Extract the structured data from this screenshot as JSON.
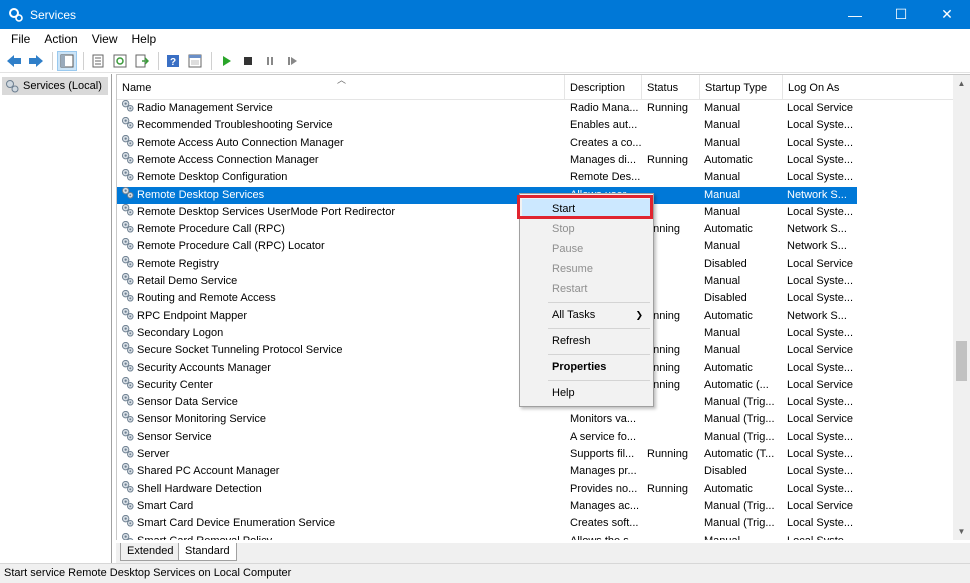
{
  "window": {
    "title": "Services",
    "minimize": "—",
    "maximize": "☐",
    "close": "✕"
  },
  "menu": [
    "File",
    "Action",
    "View",
    "Help"
  ],
  "tree": {
    "root_label": "Services (Local)"
  },
  "columns": {
    "name": "Name",
    "description": "Description",
    "status": "Status",
    "startup_type": "Startup Type",
    "log_on_as": "Log On As"
  },
  "rows": [
    {
      "name": "Radio Management Service",
      "description": "Radio Mana...",
      "status": "Running",
      "startup": "Manual",
      "logon": "Local Service"
    },
    {
      "name": "Recommended Troubleshooting Service",
      "description": "Enables aut...",
      "status": "",
      "startup": "Manual",
      "logon": "Local Syste..."
    },
    {
      "name": "Remote Access Auto Connection Manager",
      "description": "Creates a co...",
      "status": "",
      "startup": "Manual",
      "logon": "Local Syste..."
    },
    {
      "name": "Remote Access Connection Manager",
      "description": "Manages di...",
      "status": "Running",
      "startup": "Automatic",
      "logon": "Local Syste..."
    },
    {
      "name": "Remote Desktop Configuration",
      "description": "Remote Des...",
      "status": "",
      "startup": "Manual",
      "logon": "Local Syste..."
    },
    {
      "name": "Remote Desktop Services",
      "description": "Allows user...",
      "status": "",
      "startup": "Manual",
      "logon": "Network S...",
      "selected": true
    },
    {
      "name": "Remote Desktop Services UserMode Port Redirector",
      "description": "",
      "status": "",
      "startup": "Manual",
      "logon": "Local Syste..."
    },
    {
      "name": "Remote Procedure Call (RPC)",
      "description": "",
      "status": "unning",
      "startup": "Automatic",
      "logon": "Network S..."
    },
    {
      "name": "Remote Procedure Call (RPC) Locator",
      "description": "",
      "status": "",
      "startup": "Manual",
      "logon": "Network S..."
    },
    {
      "name": "Remote Registry",
      "description": "",
      "status": "",
      "startup": "Disabled",
      "logon": "Local Service"
    },
    {
      "name": "Retail Demo Service",
      "description": "",
      "status": "",
      "startup": "Manual",
      "logon": "Local Syste..."
    },
    {
      "name": "Routing and Remote Access",
      "description": "",
      "status": "",
      "startup": "Disabled",
      "logon": "Local Syste..."
    },
    {
      "name": "RPC Endpoint Mapper",
      "description": "",
      "status": "unning",
      "startup": "Automatic",
      "logon": "Network S..."
    },
    {
      "name": "Secondary Logon",
      "description": "",
      "status": "",
      "startup": "Manual",
      "logon": "Local Syste..."
    },
    {
      "name": "Secure Socket Tunneling Protocol Service",
      "description": "",
      "status": "unning",
      "startup": "Manual",
      "logon": "Local Service"
    },
    {
      "name": "Security Accounts Manager",
      "description": "",
      "status": "unning",
      "startup": "Automatic",
      "logon": "Local Syste..."
    },
    {
      "name": "Security Center",
      "description": "",
      "status": "unning",
      "startup": "Automatic (...",
      "logon": "Local Service"
    },
    {
      "name": "Sensor Data Service",
      "description": "",
      "status": "",
      "startup": "Manual (Trig...",
      "logon": "Local Syste..."
    },
    {
      "name": "Sensor Monitoring Service",
      "description": "Monitors va...",
      "status": "",
      "startup": "Manual (Trig...",
      "logon": "Local Service"
    },
    {
      "name": "Sensor Service",
      "description": "A service fo...",
      "status": "",
      "startup": "Manual (Trig...",
      "logon": "Local Syste..."
    },
    {
      "name": "Server",
      "description": "Supports fil...",
      "status": "Running",
      "startup": "Automatic (T...",
      "logon": "Local Syste..."
    },
    {
      "name": "Shared PC Account Manager",
      "description": "Manages pr...",
      "status": "",
      "startup": "Disabled",
      "logon": "Local Syste..."
    },
    {
      "name": "Shell Hardware Detection",
      "description": "Provides no...",
      "status": "Running",
      "startup": "Automatic",
      "logon": "Local Syste..."
    },
    {
      "name": "Smart Card",
      "description": "Manages ac...",
      "status": "",
      "startup": "Manual (Trig...",
      "logon": "Local Service"
    },
    {
      "name": "Smart Card Device Enumeration Service",
      "description": "Creates soft...",
      "status": "",
      "startup": "Manual (Trig...",
      "logon": "Local Syste..."
    },
    {
      "name": "Smart Card Removal Policy",
      "description": "Allows the s...",
      "status": "",
      "startup": "Manual",
      "logon": "Local Syste..."
    }
  ],
  "context_menu": {
    "start": "Start",
    "stop": "Stop",
    "pause": "Pause",
    "resume": "Resume",
    "restart": "Restart",
    "all_tasks": "All Tasks",
    "refresh": "Refresh",
    "properties": "Properties",
    "help": "Help"
  },
  "tabs": {
    "extended": "Extended",
    "standard": "Standard"
  },
  "status_text": "Start service Remote Desktop Services on Local Computer",
  "colors": {
    "titlebar": "#0078d7",
    "selection": "#0078d7",
    "highlight_box": "#e0242f"
  }
}
